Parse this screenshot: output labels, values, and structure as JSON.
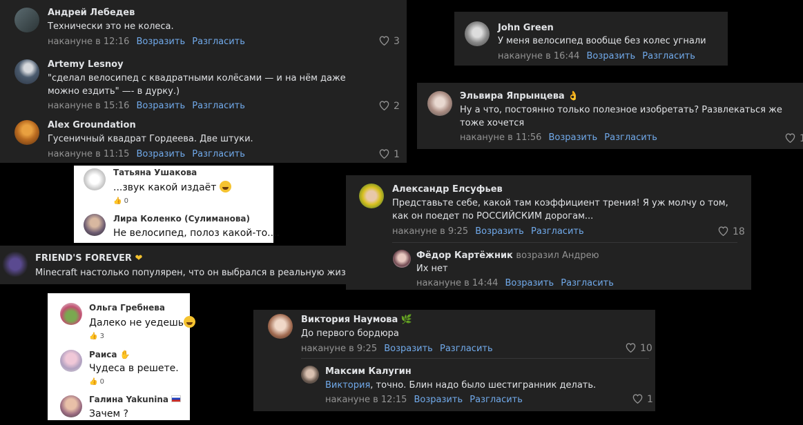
{
  "panels": {
    "p1": {
      "comments": [
        {
          "author": "Андрей Лебедев",
          "text": "Технически это не колеса.",
          "time": "накануне в 12:16",
          "reply": "Возразить",
          "agree": "Разгласить",
          "likes": "3"
        },
        {
          "author": "Artemy Lesnoy",
          "text": "\"сделал велосипед с квадратными колёсами — и на нём даже можно ездить\" —- в дурку.)",
          "time": "накануне в 15:16",
          "reply": "Возразить",
          "agree": "Разгласить",
          "likes": "2"
        },
        {
          "author": "Alex Groundation",
          "text": "Гусеничный квадрат Гордеева. Две штуки.",
          "time": "накануне в 11:15",
          "reply": "Возразить",
          "agree": "Разгласить",
          "likes": "1"
        }
      ]
    },
    "p2": {
      "comments": [
        {
          "author": "Татьяна Ушакова",
          "text": "...звук какой издаёт",
          "likes": "0"
        },
        {
          "author": "Лира Коленко (Сулиманова)",
          "text": "Не велосипед, полоз какой-то...."
        }
      ]
    },
    "p3": {
      "author": "FRIEND'S FOREVER",
      "text": "Minecraft настолько популярен, что он выбрался в реальную жизнь"
    },
    "p4": {
      "comments": [
        {
          "author": "Ольга Гребнева",
          "text": "Далеко не уедешь",
          "likes": "3"
        },
        {
          "author": "Раиса",
          "text": "Чудеса в решете.",
          "likes": "0"
        },
        {
          "author": "Галина Yakunina",
          "text": "Зачем ?"
        }
      ]
    },
    "p5": {
      "author": "John Green",
      "text": "У меня велосипед вообще без колес угнали",
      "time": "накануне в 16:44",
      "reply": "Возразить",
      "agree": "Разгласить"
    },
    "p6": {
      "author": "Эльвира Япрынцева",
      "text": "Ну а что, постоянно только полезное изобретать? Развлекаться же тоже хочется",
      "time": "накануне в 11:56",
      "reply": "Возразить",
      "agree": "Разгласить",
      "likes": "1"
    },
    "p7": {
      "author": "Александр Елсуфьев",
      "text": "Представьте себе, какой там коэффициент трения! Я уж молчу о том, как он поедет по РОССИЙСКИМ дорогам...",
      "time": "накануне в 9:25",
      "reply": "Возразить",
      "agree": "Разгласить",
      "likes": "18",
      "sub": {
        "author": "Фёдор Картёжник",
        "replied_to": "возразил Андрею",
        "text": "Их нет",
        "time": "накануне в 14:44",
        "reply": "Возразить",
        "agree": "Разгласить"
      }
    },
    "p8": {
      "author": "Виктория Наумова",
      "text": "До первого бордюра",
      "time": "накануне в 9:25",
      "reply": "Возразить",
      "agree": "Разгласить",
      "likes": "10",
      "sub": {
        "author": "Максим Калугин",
        "mention": "Виктория",
        "text": ", точно. Блин надо было шестигранник делать.",
        "time": "накануне в 12:15",
        "reply": "Возразить",
        "agree": "Разгласить",
        "likes": "1"
      }
    }
  },
  "colors": {
    "link": "#71aaeb",
    "muted": "#939393",
    "dark_bg": "#222222"
  }
}
